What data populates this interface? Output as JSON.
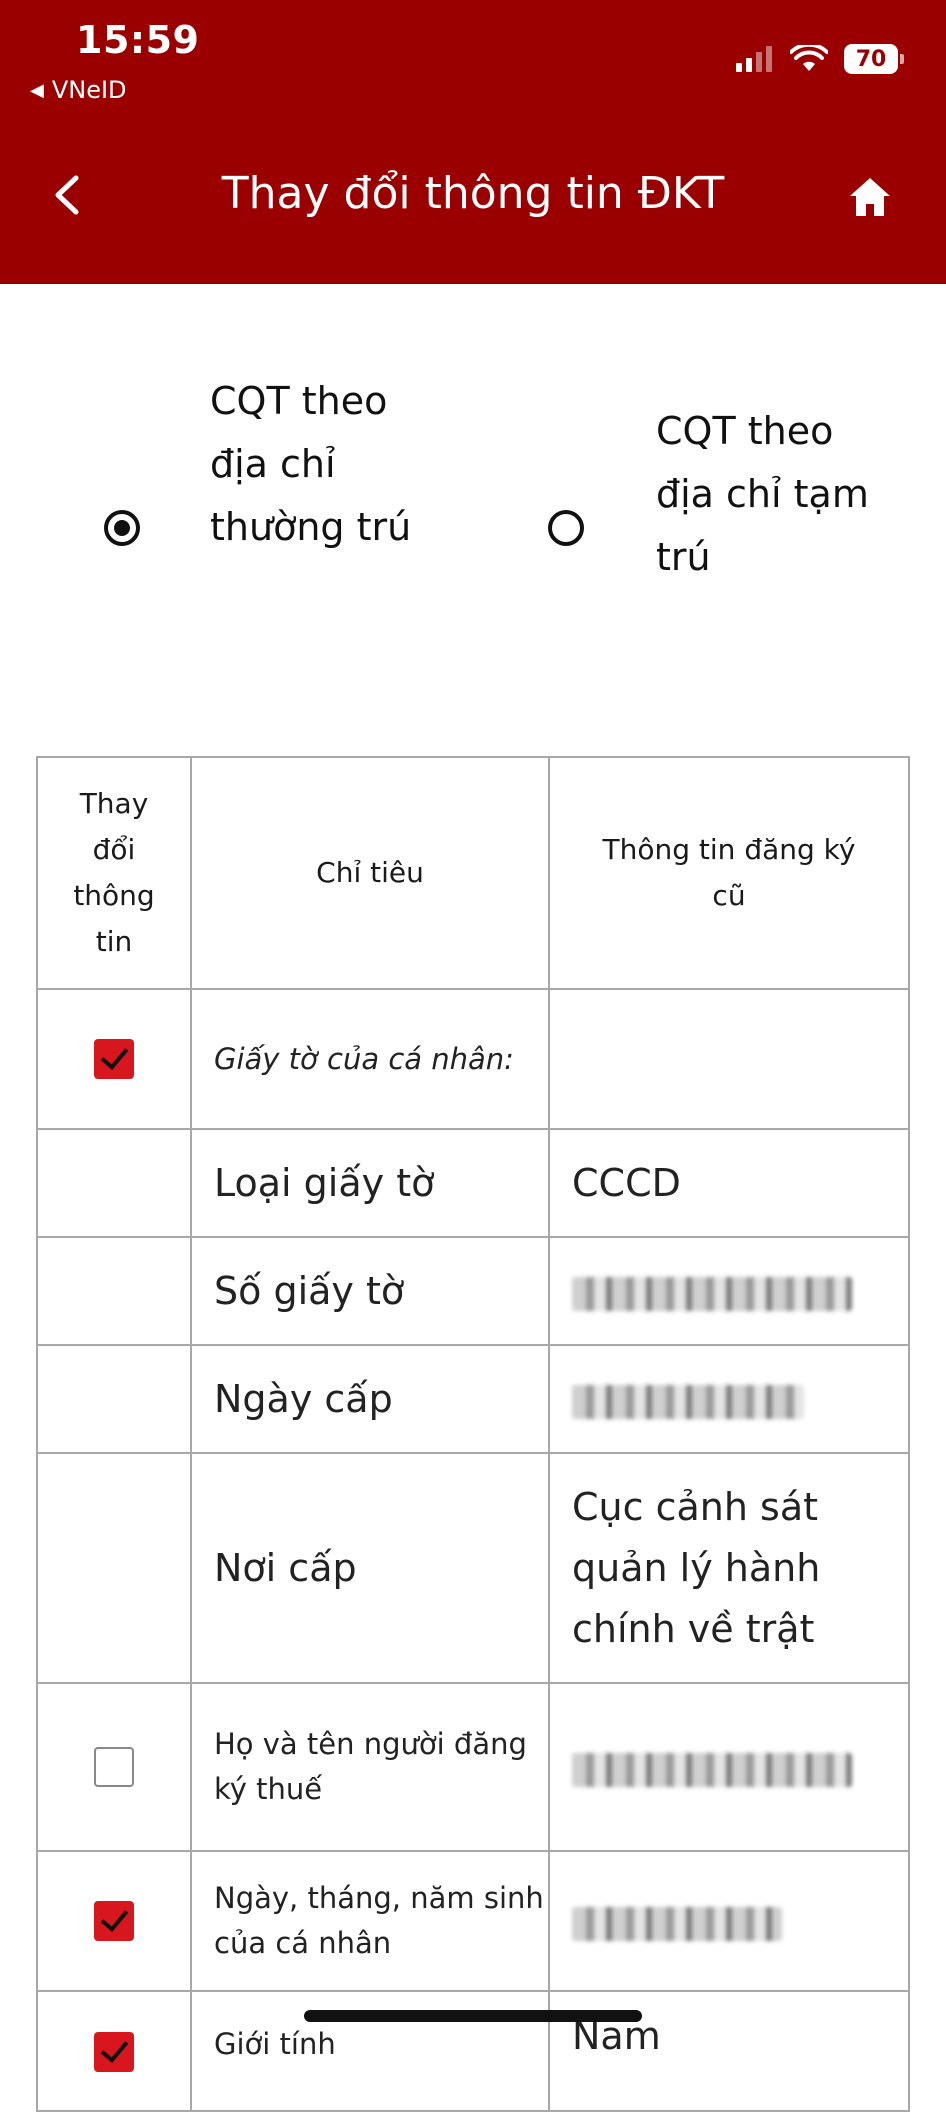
{
  "status_bar": {
    "time": "15:59",
    "back_app": "VNeID",
    "battery": "70"
  },
  "nav": {
    "title": "Thay đổi thông tin ĐKT"
  },
  "radio_options": [
    {
      "label": "CQT theo địa chỉ thường trú",
      "selected": true
    },
    {
      "label": "CQT theo địa chỉ tạm trú",
      "selected": false
    }
  ],
  "table": {
    "headers": [
      "Thay đổi thông tin",
      "Chỉ tiêu",
      "Thông tin đăng ký cũ"
    ],
    "rows": [
      {
        "checked": true,
        "indicator": "Giấy tờ của cá nhân:",
        "old": ""
      },
      {
        "checked": null,
        "indicator": "Loại giấy tờ",
        "old": "CCCD"
      },
      {
        "checked": null,
        "indicator": "Số giấy tờ",
        "old": ""
      },
      {
        "checked": null,
        "indicator": "Ngày cấp",
        "old": ""
      },
      {
        "checked": null,
        "indicator": "Nơi cấp",
        "old": "Cục cảnh sát quản lý hành chính về trật"
      },
      {
        "checked": false,
        "indicator": "Họ và tên người đăng ký thuế",
        "old": ""
      },
      {
        "checked": true,
        "indicator": "Ngày, tháng, năm sinh của cá nhân",
        "old": ""
      },
      {
        "checked": true,
        "indicator": "Giới tính",
        "old": "Nam"
      }
    ]
  },
  "colors": {
    "header_bg": "#9b0000",
    "checkbox_on": "#d7161d"
  }
}
